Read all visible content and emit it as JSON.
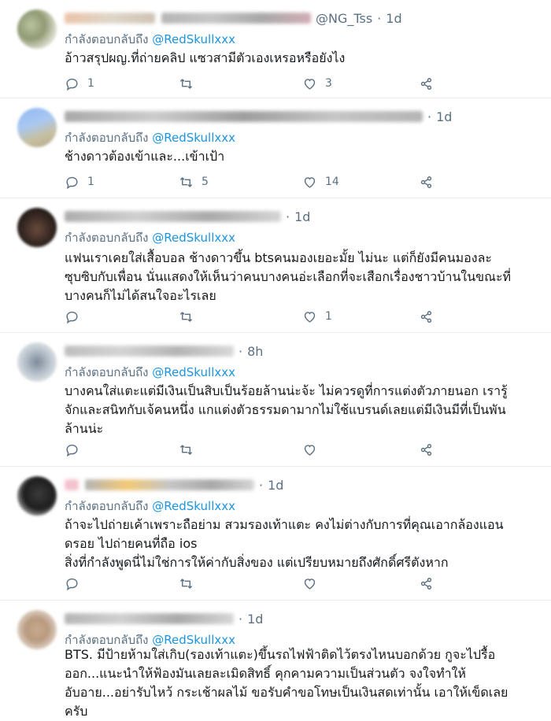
{
  "tweets": [
    {
      "reply_label": "กำลังตอบกลับถึง",
      "mention": "@RedSkullxxx",
      "handle": "@NG_Tss",
      "separator": "·",
      "time": "1d",
      "lines": [
        "อ้าวสรุปผญ.ที่ถ่ายคลิป แซวสามีตัวเองเหรอหรือยังไง"
      ],
      "reply_count": "1",
      "retweet_count": "",
      "like_count": "3"
    },
    {
      "reply_label": "กำลังตอบกลับถึง",
      "mention": "@RedSkullxxx",
      "handle": "",
      "separator": "·",
      "time": "1d",
      "lines": [
        "ช้างดาวต้องเข้าและ...เข้าเป้า"
      ],
      "reply_count": "1",
      "retweet_count": "5",
      "like_count": "14"
    },
    {
      "reply_label": "กำลังตอบกลับถึง",
      "mention": "@RedSkullxxx",
      "handle": "",
      "separator": "·",
      "time": "1d",
      "lines": [
        "แฟนเราเคยใส่เสื้อบอล ช้างดาวขึ้น btsคนมองเยอะมั้ย ไม่นะ แต่ก็ยังมีคนมองละ",
        "ซุบซิบกับเพื่อน นั่นแสดงให้เห็นว่าคนบางคนอ่ะเลือกที่จะเสือกเรื่องชาวบ้านในขณะที่",
        "บางคนก็ไม่ได้สนใจอะไรเลย"
      ],
      "reply_count": "",
      "retweet_count": "",
      "like_count": "1"
    },
    {
      "reply_label": "กำลังตอบกลับถึง",
      "mention": "@RedSkullxxx",
      "handle": "",
      "separator": "·",
      "time": "8h",
      "lines": [
        "บางคนใส่แตะแต่มีเงินเป็นสิบเป็นร้อยล้านน่ะจ้ะ ไม่ควรดูที่การแต่งตัวภายนอก เรารู้",
        "จักและสนิทกับเจ้คนหนึ่ง แกแต่งตัวธรรมดามากไม่ใช้แบรนด์เลยแต่มีเงินมีที่เป็นพัน",
        "ล้านน่ะ"
      ],
      "reply_count": "",
      "retweet_count": "",
      "like_count": ""
    },
    {
      "reply_label": "กำลังตอบกลับถึง",
      "mention": "@RedSkullxxx",
      "handle": "",
      "separator": "·",
      "time": "1d",
      "lines": [
        "ถ้าจะไปถ่ายเค้าเพราะถือย่าม สวมรองเท้าแตะ คงไม่ต่างกับการที่คุณเอากล้องแอน",
        "ดรอย ไปถ่ายคนที่ถือ ios",
        "สิ่งที่กำลังพูดนี่ไม่ใช่การให้ค่ากับสิ่งของ แต่เปรียบหมายถึงศักดิ์ศรีตังหาก"
      ],
      "reply_count": "",
      "retweet_count": "",
      "like_count": ""
    },
    {
      "reply_label": "กำลังตอบกลับถึง",
      "mention": "@RedSkullxxx",
      "handle": "",
      "separator": "·",
      "time": "1d",
      "lines": [
        "BTS. มีป้ายห้ามใส่เกิบ(รองเท้าแตะ)ขึ้นรถไฟฟ้าติดไว้ตรงไหนบอกด้วย กูจะไปรื้อ",
        "ออก...แนะนำให้ฟ้องมันเลยละเมิดสิทธิ์ คุกคามความเป็นส่วนตัว จงใจทำให้",
        "อับอาย...อย่ารับไหว้ กระเช้าผลไม้ ขอรับคำขอโทษเป็นเงินสดเท่านั้น เอาให้เข็ดเลย",
        "ครับ"
      ],
      "reply_count": "",
      "retweet_count": "",
      "like_count": ""
    }
  ],
  "icons": {
    "reply": "reply-icon",
    "retweet": "retweet-icon",
    "like": "like-icon",
    "share": "share-icon"
  },
  "colors": {
    "mention": "#1b95e0",
    "muted": "#5b7083",
    "text": "#14171a",
    "divider": "#e6ecf0"
  }
}
